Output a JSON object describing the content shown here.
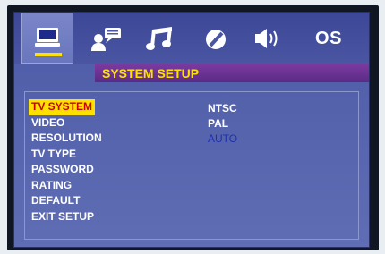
{
  "tabs": [
    {
      "name": "monitor-icon",
      "label": ""
    },
    {
      "name": "user-speech-icon",
      "label": ""
    },
    {
      "name": "music-note-icon",
      "label": ""
    },
    {
      "name": "disc-icon",
      "label": ""
    },
    {
      "name": "speaker-icon",
      "label": ""
    },
    {
      "name": "os-tab",
      "label": "OS"
    }
  ],
  "header": {
    "title": "SYSTEM SETUP"
  },
  "menu": {
    "items": [
      "TV SYSTEM",
      "VIDEO",
      "RESOLUTION",
      "TV TYPE",
      "PASSWORD",
      "RATING",
      "DEFAULT",
      "EXIT SETUP"
    ],
    "selected": "TV SYSTEM"
  },
  "options": {
    "items": [
      "NTSC",
      "PAL",
      "AUTO"
    ],
    "current": "AUTO"
  },
  "colors": {
    "highlight": "#ffe100",
    "selected_text": "#c70000",
    "current_option": "#1f2fb0",
    "header_bg": "#6a3196",
    "panel_bg": "#5563ad"
  }
}
